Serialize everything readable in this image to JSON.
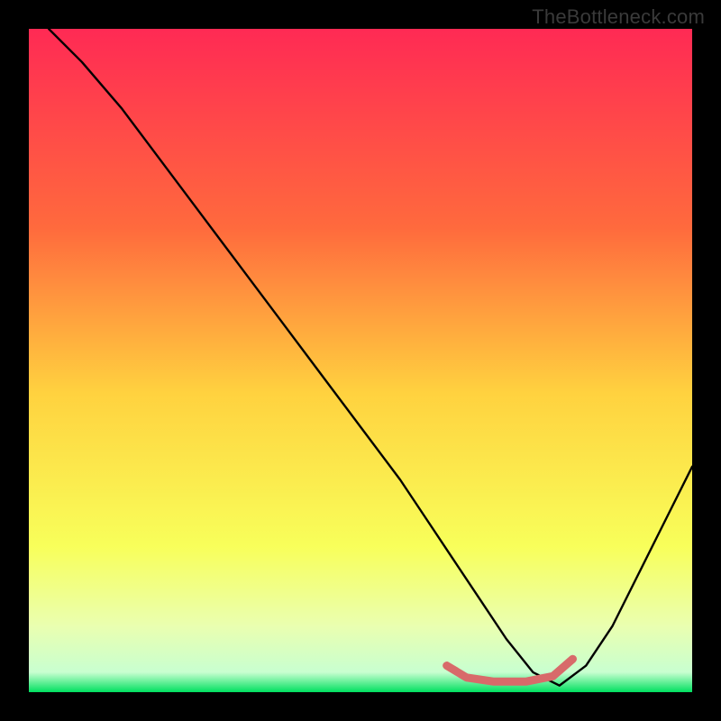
{
  "watermark": "TheBottleneck.com",
  "chart_data": {
    "type": "line",
    "title": "",
    "xlabel": "",
    "ylabel": "",
    "xlim": [
      0,
      100
    ],
    "ylim": [
      0,
      100
    ],
    "grid": false,
    "curve_x": [
      3,
      8,
      14,
      20,
      26,
      32,
      38,
      44,
      50,
      56,
      60,
      64,
      68,
      72,
      76,
      80,
      84,
      88,
      92,
      96,
      100
    ],
    "curve_y": [
      100,
      95,
      88,
      80,
      72,
      64,
      56,
      48,
      40,
      32,
      26,
      20,
      14,
      8,
      3,
      1,
      4,
      10,
      18,
      26,
      34
    ],
    "highlight_segment_x": [
      63,
      66,
      70,
      75,
      79,
      82
    ],
    "highlight_segment_y": [
      4.0,
      2.2,
      1.6,
      1.6,
      2.4,
      5.0
    ],
    "background_gradient_stops": [
      {
        "offset": 0.0,
        "color": "#ff2a54"
      },
      {
        "offset": 0.3,
        "color": "#ff6a3d"
      },
      {
        "offset": 0.55,
        "color": "#ffd23f"
      },
      {
        "offset": 0.78,
        "color": "#f8ff5a"
      },
      {
        "offset": 0.9,
        "color": "#eaffb0"
      },
      {
        "offset": 0.97,
        "color": "#c8ffd0"
      },
      {
        "offset": 1.0,
        "color": "#00e060"
      }
    ],
    "highlight_color": "#d86a6a",
    "curve_color": "#000000"
  }
}
